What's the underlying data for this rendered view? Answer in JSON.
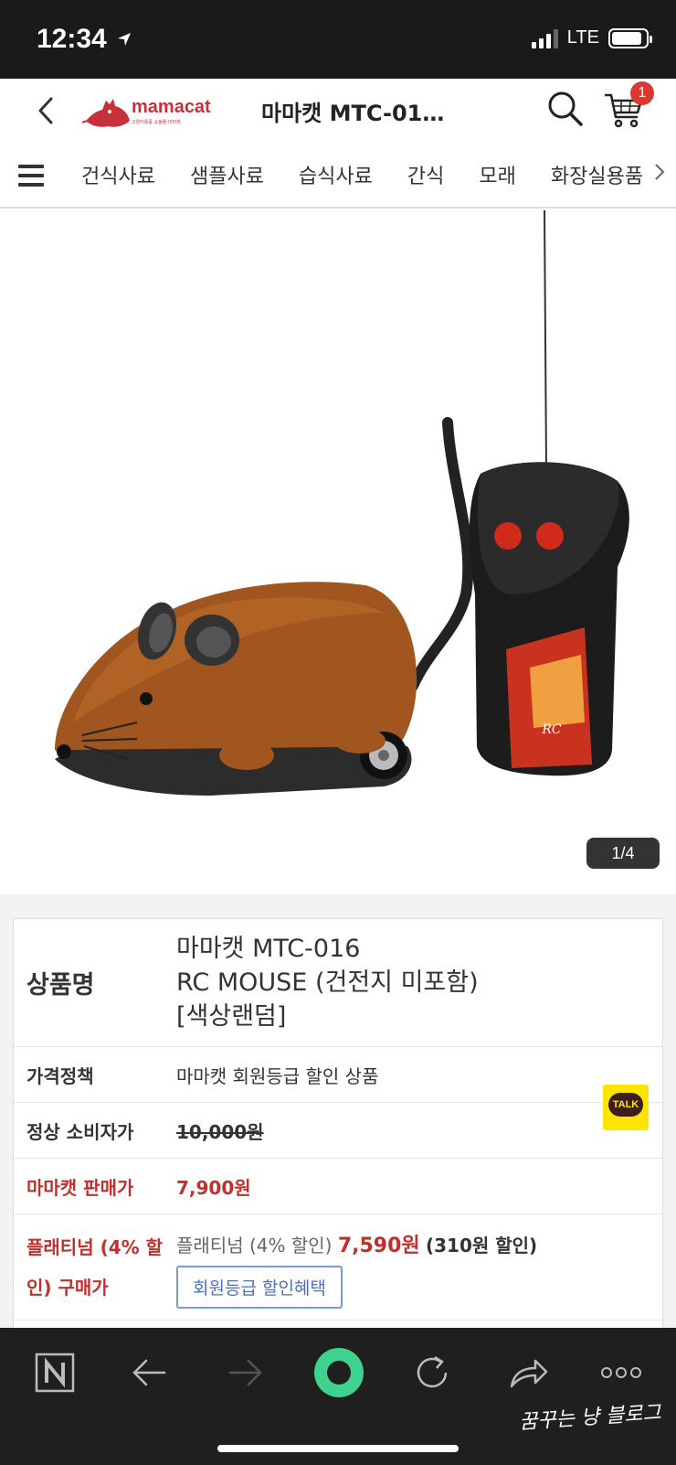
{
  "status_bar": {
    "time": "12:34",
    "network": "LTE",
    "location_icon": "location-arrow-icon"
  },
  "header": {
    "logo_text": "mamacat",
    "logo_subtext": "고양이용품 쇼핑몰 마마캣",
    "title": "마마캣 MTC-01…",
    "cart_count": "1",
    "brand_color": "#c8303a"
  },
  "categories": [
    "건식사료",
    "샘플사료",
    "습식사료",
    "간식",
    "모래",
    "화장실용품"
  ],
  "gallery": {
    "counter": "1/4"
  },
  "product": {
    "name_label": "상품명",
    "name_line1": "마마캣 MTC-016",
    "name_line2": "RC MOUSE (건전지 미포함)",
    "name_line3": "[색상랜덤]",
    "policy_label": "가격정책",
    "policy_value": "마마캣 회원등급 할인 상품",
    "msrp_label": "정상 소비자가",
    "msrp_value": "10,000원",
    "sale_label": "마마캣 판매가",
    "sale_value": "7,900원",
    "platinum_label": "플래티넘 (4% 할인) 구매가",
    "platinum_prefix": "플래티넘 (4% 할인)",
    "platinum_price": "7,590원",
    "platinum_discount": "(310원 할인)",
    "benefit_button": "회원등급 할인혜택",
    "accent_color": "#c0302c"
  },
  "talk": {
    "label": "TALK"
  },
  "watermark": "꿈꾸는 냥 블로그"
}
